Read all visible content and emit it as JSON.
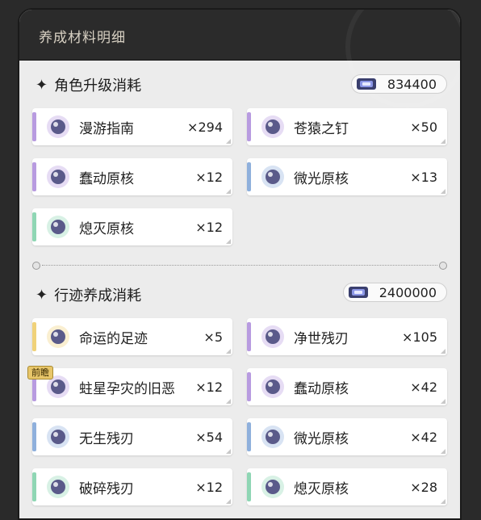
{
  "header": {
    "title": "养成材料明细"
  },
  "section1": {
    "title": "角色升级消耗",
    "cost": "834400",
    "items": [
      {
        "name": "漫游指南",
        "qty": "×294",
        "rarity": "#b89be0"
      },
      {
        "name": "苍猿之钉",
        "qty": "×50",
        "rarity": "#b89be0"
      },
      {
        "name": "蠢动原核",
        "qty": "×12",
        "rarity": "#b89be0"
      },
      {
        "name": "微光原核",
        "qty": "×13",
        "rarity": "#8fb0dc"
      },
      {
        "name": "熄灭原核",
        "qty": "×12",
        "rarity": "#8fd6b4"
      }
    ]
  },
  "section2": {
    "title": "行迹养成消耗",
    "cost": "2400000",
    "items": [
      {
        "name": "命运的足迹",
        "qty": "×5",
        "rarity": "#f0d27a"
      },
      {
        "name": "净世残刃",
        "qty": "×105",
        "rarity": "#b89be0"
      },
      {
        "name": "蛀星孕灾的旧恶",
        "qty": "×12",
        "rarity": "#b89be0",
        "badge": "前瞻"
      },
      {
        "name": "蠢动原核",
        "qty": "×42",
        "rarity": "#b89be0"
      },
      {
        "name": "无生残刃",
        "qty": "×54",
        "rarity": "#8fb0dc"
      },
      {
        "name": "微光原核",
        "qty": "×42",
        "rarity": "#8fb0dc"
      },
      {
        "name": "破碎残刃",
        "qty": "×12",
        "rarity": "#8fd6b4"
      },
      {
        "name": "熄灭原核",
        "qty": "×28",
        "rarity": "#8fd6b4"
      }
    ]
  },
  "icons": {
    "star": "four-point-star-icon",
    "credit": "credit-coin-icon"
  }
}
